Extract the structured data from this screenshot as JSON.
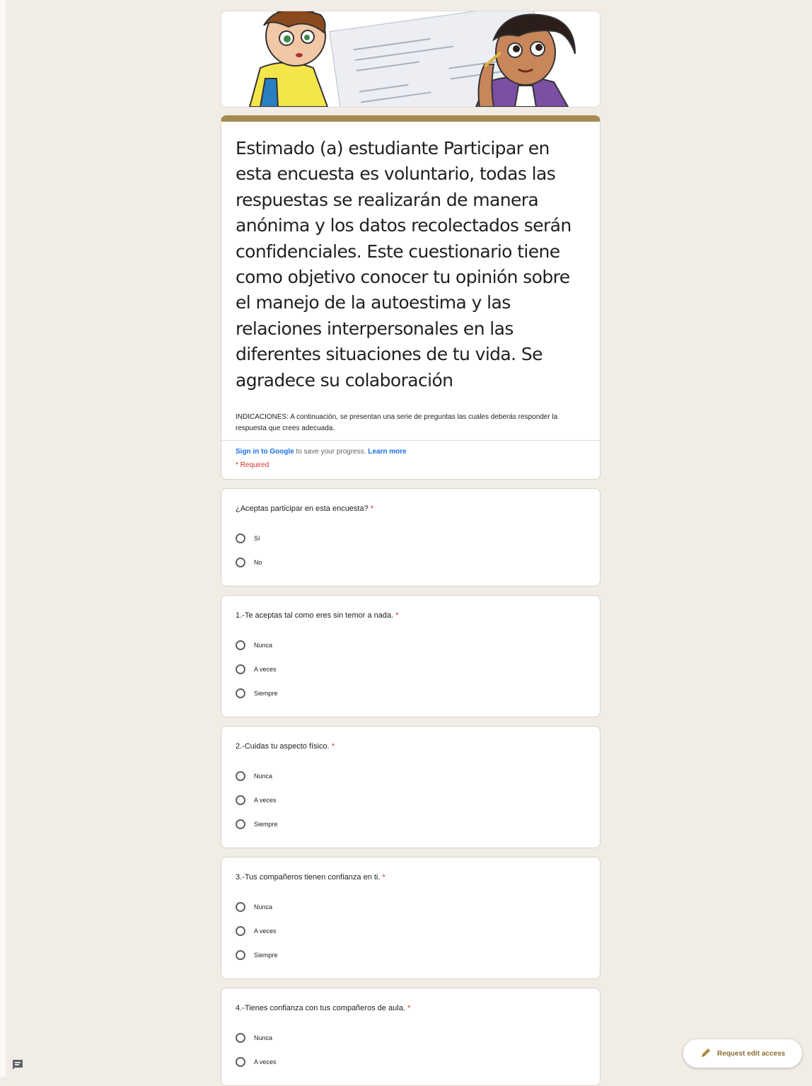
{
  "form": {
    "title": "Estimado (a) estudiante Participar en esta encuesta es voluntario, todas las respuestas se realizarán de manera anónima y los datos recolectados serán confidenciales. Este cuestionario tiene como objetivo conocer tu opinión sobre el manejo de la autoestima y las relaciones interpersonales en las diferentes situaciones de tu vida. Se agradece su colaboración",
    "description": "INDICACIONES: A continuación, se presentan una serie de preguntas las cuales deberás responder la respuesta que crees adecuada.",
    "sign_in_link": "Sign in to Google",
    "sign_in_text": " to save your progress. ",
    "learn_more": "Learn more",
    "required_note": "* Required"
  },
  "questions": [
    {
      "title": "¿Aceptas participar en esta encuesta?",
      "required_mark": "*",
      "options": [
        "Sí",
        "No"
      ]
    },
    {
      "title": "1.-Te aceptas tal como eres sin temor a nada.",
      "required_mark": "*",
      "options": [
        "Nunca",
        "A veces",
        "Siempre"
      ]
    },
    {
      "title": "2.-Cuidas tu aspecto físico.",
      "required_mark": "*",
      "options": [
        "Nunca",
        "A veces",
        "Siempre"
      ]
    },
    {
      "title": "3.-Tus compañeros tienen confianza en ti.",
      "required_mark": "*",
      "options": [
        "Nunca",
        "A veces",
        "Siempre"
      ]
    },
    {
      "title": "4.-Tienes confianza con tus compañeros de aula.",
      "required_mark": "*",
      "options": [
        "Nunca",
        "A veces"
      ]
    }
  ],
  "edit_access": {
    "label": "Request edit access",
    "icon": "pencil-icon"
  },
  "feedback": {
    "icon": "feedback-icon"
  },
  "colors": {
    "accent": "#a58a54",
    "background": "#f1ede6",
    "required": "#d93025",
    "link": "#1a73e8"
  }
}
